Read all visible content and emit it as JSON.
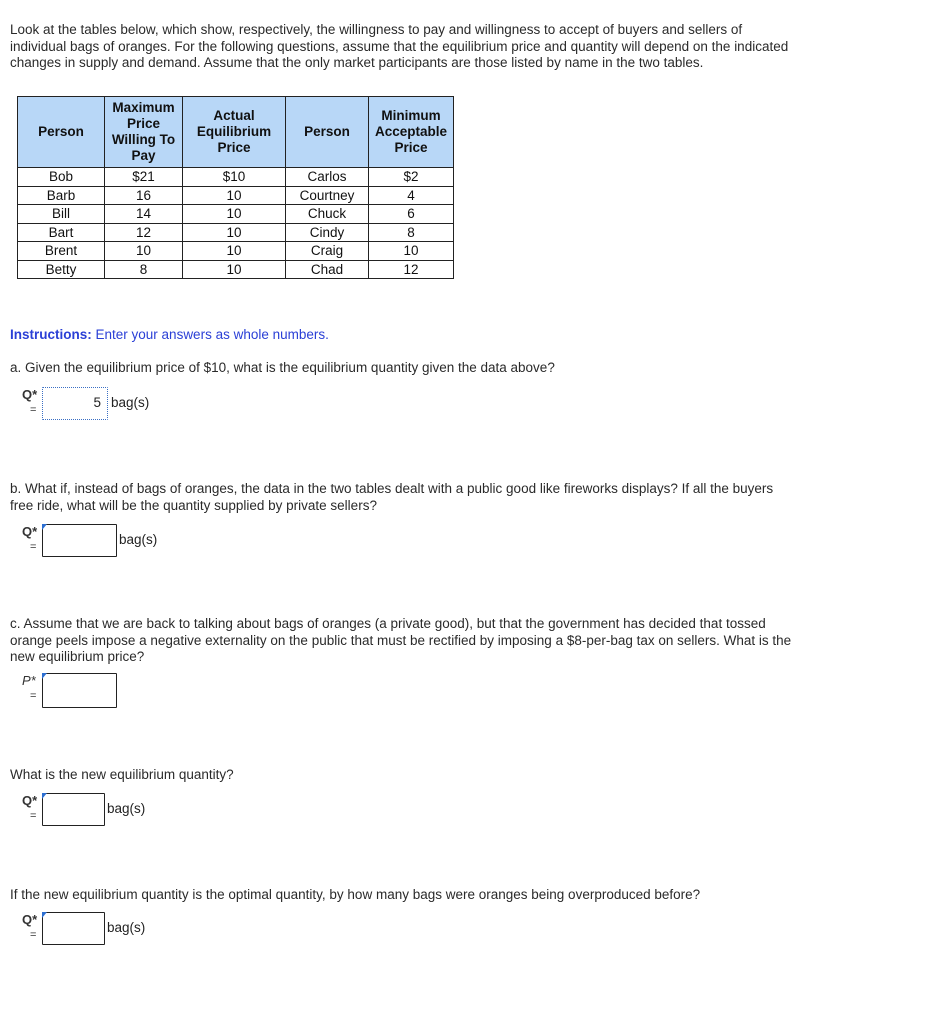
{
  "intro": "Look at the tables below, which show, respectively, the willingness to pay and willingness to accept of buyers and sellers of individual bags of oranges. For the following questions, assume that the equilibrium price and quantity will depend on the indicated changes in supply and demand. Assume that the only market participants are those listed by name in the two tables.",
  "table": {
    "headers": [
      "Person",
      "Maximum Price Willing To Pay",
      "Actual Equilibrium Price",
      "Person",
      "Minimum Acceptable Price"
    ],
    "rows": [
      [
        "Bob",
        "$21",
        "$10",
        "Carlos",
        "$2"
      ],
      [
        "Barb",
        "16",
        "10",
        "Courtney",
        "4"
      ],
      [
        "Bill",
        "14",
        "10",
        "Chuck",
        "6"
      ],
      [
        "Bart",
        "12",
        "10",
        "Cindy",
        "8"
      ],
      [
        "Brent",
        "10",
        "10",
        "Craig",
        "10"
      ],
      [
        "Betty",
        "8",
        "10",
        "Chad",
        "12"
      ]
    ],
    "header_color": "#b8d7f7"
  },
  "instructions": {
    "label": "Instructions:",
    "text": " Enter your answers as whole numbers.",
    "color": "#2a3fd6"
  },
  "questions": {
    "a": {
      "text": "a. Given the equilibrium price of $10, what is the equilibrium quantity given the data above?",
      "var": "Q*",
      "eq": "=",
      "value": "5",
      "unit": "bag(s)"
    },
    "b": {
      "text": "b. What if, instead of bags of oranges, the data in the two tables dealt with a public good like fireworks displays? If all the buyers free ride, what will be the quantity supplied by private sellers?",
      "var": "Q*",
      "eq": "=",
      "value": "",
      "unit": "bag(s)"
    },
    "c": {
      "text": "c. Assume that we are back to talking about bags of oranges (a private good), but that the government has decided that tossed orange peels impose a negative externality on the public that must be rectified by imposing a $8-per-bag tax on sellers. What is the new equilibrium price?",
      "var": "P*",
      "eq": "=",
      "value": ""
    },
    "d": {
      "text": "What is the new equilibrium quantity?",
      "var": "Q*",
      "eq": "=",
      "value": "",
      "unit": "bag(s)"
    },
    "e": {
      "text": "If the new equilibrium quantity is the optimal quantity, by how many bags were oranges being overproduced before?",
      "var": "Q*",
      "eq": "=",
      "value": "",
      "unit": "bag(s)"
    }
  }
}
